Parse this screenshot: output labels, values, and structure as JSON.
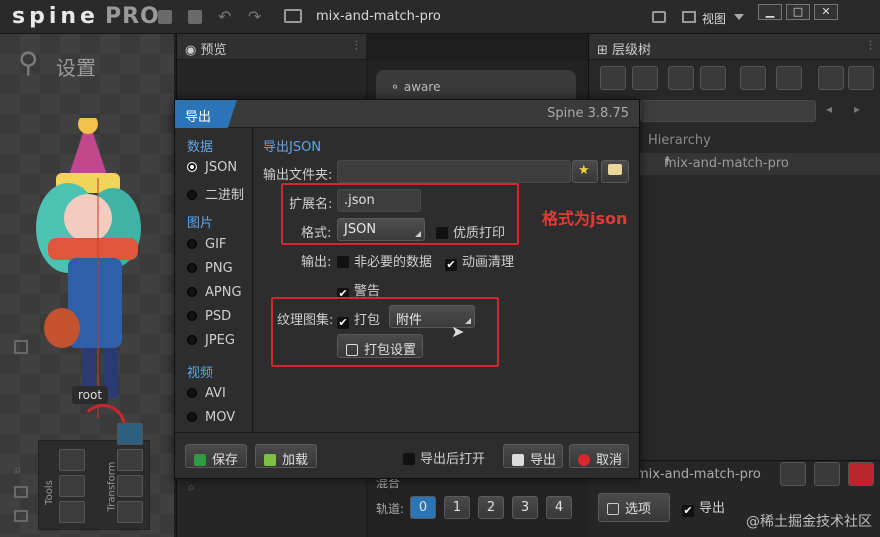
{
  "app": {
    "logo_text": "spine",
    "logo_suffix": "PRO",
    "project_title": "mix-and-match-pro",
    "view_label": "视图"
  },
  "window_buttons": [
    "▁",
    "□",
    "✕"
  ],
  "canvas": {
    "mode_label": "设置",
    "root_label": "root",
    "tools_label": "Tools",
    "transform_label": "Transform"
  },
  "preview": {
    "title": "预览",
    "anim_item": "aware"
  },
  "tree": {
    "title": "层级树",
    "hierarchy_header": "Hierarchy",
    "root_node": "mix-and-match-pro",
    "bottom_node": "mix-and-match-pro",
    "options_label": "选项",
    "export_label": "导出"
  },
  "animation_bottom": {
    "mix_label": "混合",
    "track_label": "轨道:",
    "tracks": [
      "0",
      "1",
      "2",
      "3",
      "4"
    ]
  },
  "dialog": {
    "title": "导出",
    "version": "Spine 3.8.75",
    "sidebar": {
      "data_section": "数据",
      "data_items": [
        {
          "label": "JSON",
          "selected": true
        },
        {
          "label": "二进制",
          "selected": false
        }
      ],
      "image_section": "图片",
      "image_items": [
        "GIF",
        "PNG",
        "APNG",
        "PSD",
        "JPEG"
      ],
      "video_section": "视频",
      "video_items": [
        "AVI",
        "MOV"
      ]
    },
    "content": {
      "heading": "导出JSON",
      "output_folder_label": "输出文件夹:",
      "output_folder_value": "",
      "extension_label": "扩展名:",
      "extension_value": ".json",
      "format_label": "格式:",
      "format_value": "JSON",
      "pretty_print_label": "优质打印",
      "pretty_print_checked": false,
      "output_label": "输出:",
      "nonessential_label": "非必要的数据",
      "nonessential_checked": false,
      "anim_clean_label": "动画清理",
      "anim_clean_checked": true,
      "warnings_label": "警告",
      "warnings_checked": true,
      "atlas_label": "纹理图集:",
      "pack_label": "打包",
      "pack_checked": true,
      "pack_mode_value": "附件",
      "pack_settings_label": "打包设置"
    },
    "footer": {
      "save_label": "保存",
      "load_label": "加载",
      "open_after_label": "导出后打开",
      "open_after_checked": false,
      "export_label": "导出",
      "cancel_label": "取消"
    }
  },
  "annotation": {
    "text": "格式为json",
    "color": "#e53935"
  },
  "watermark": "@稀土掘金技术社区",
  "colors": {
    "accent": "#2c74b8",
    "highlight_box": "#d8262e"
  }
}
